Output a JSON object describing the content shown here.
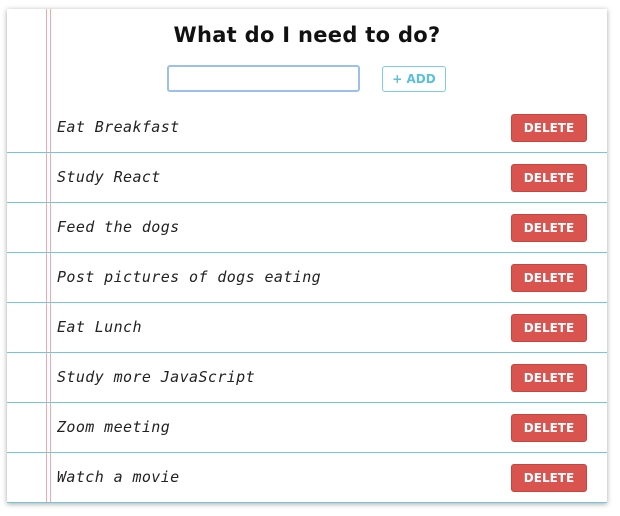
{
  "header": {
    "title": "What do I need to do?"
  },
  "entry": {
    "input_value": "",
    "add_label": "+ ADD"
  },
  "todos": [
    {
      "text": "Eat Breakfast",
      "delete_label": "DELETE"
    },
    {
      "text": "Study React",
      "delete_label": "DELETE"
    },
    {
      "text": "Feed the dogs",
      "delete_label": "DELETE"
    },
    {
      "text": "Post pictures of dogs eating",
      "delete_label": "DELETE"
    },
    {
      "text": "Eat Lunch",
      "delete_label": "DELETE"
    },
    {
      "text": "Study more JavaScript",
      "delete_label": "DELETE"
    },
    {
      "text": "Zoom meeting",
      "delete_label": "DELETE"
    },
    {
      "text": "Watch a movie",
      "delete_label": "DELETE"
    }
  ],
  "colors": {
    "margin_line": "#f4a9a9",
    "rule_line": "#72c7d9",
    "delete_bg": "#d9534f",
    "add_text": "#5bc0de"
  }
}
